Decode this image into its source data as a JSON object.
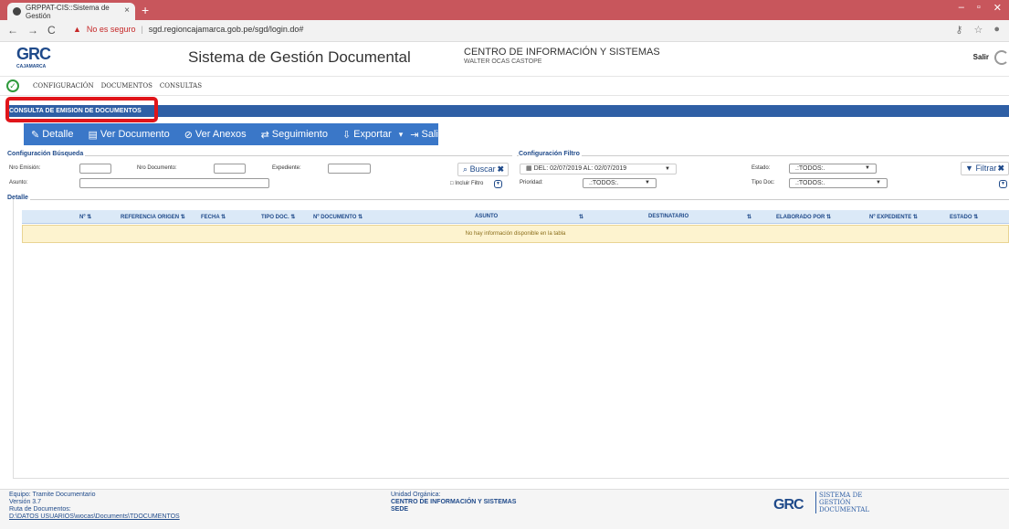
{
  "browser": {
    "tab_title": "GRPPAT-CIS::Sistema de Gestión",
    "tab_close": "×",
    "new_tab": "+",
    "not_secure": "No es seguro",
    "url": "sgd.regioncajamarca.gob.pe/sgd/login.do#"
  },
  "header": {
    "logo": "GRC",
    "logo_sub": "CAJAMARCA",
    "title": "Sistema de Gestión Documental",
    "unit": "CENTRO DE INFORMACIÓN Y SISTEMAS",
    "user": "WALTER OCAS CASTOPE",
    "exit": "Salir"
  },
  "menu": [
    "CONFIGURACIÓN",
    "DOCUMENTOS",
    "CONSULTAS"
  ],
  "panel_title": "CONSULTA DE EMISION DE DOCUMENTOS",
  "toolbar": {
    "detalle": "Detalle",
    "ver_documento": "Ver Documento",
    "ver_anexos": "Ver Anexos",
    "seguimiento": "Seguimiento",
    "exportar": "Exportar",
    "salir": "Salir"
  },
  "busqueda": {
    "legend": "Configuración Búsqueda",
    "nro_emision": "Nro Emisión:",
    "nro_documento": "Nro Documento:",
    "expediente": "Expediente:",
    "asunto": "Asunto:",
    "buscar": "Buscar",
    "incluir_filtro": "Incluir Filtro"
  },
  "filtro": {
    "legend": "Configuración Filtro",
    "fecha": "DEL: 02/07/2019 AL: 02/07/2019",
    "prioridad_label": "Prioridad:",
    "prioridad_value": ".:TODOS:.",
    "estado_label": "Estado:",
    "estado_value": ".:TODOS:.",
    "tipo_doc_label": "Tipo Doc:",
    "tipo_doc_value": ".:TODOS:.",
    "filtrar": "Filtrar"
  },
  "detalle": {
    "legend": "Detalle",
    "columns": [
      "Nº",
      "REFERENCIA ORIGEN",
      "FECHA",
      "TIPO DOC.",
      "Nº DOCUMENTO",
      "ASUNTO",
      "DESTINATARIO",
      "ELABORADO POR",
      "Nº EXPEDIENTE",
      "ESTADO"
    ],
    "empty": "No hay información disponible en la tabla"
  },
  "footer": {
    "equipo": "Equipo: Tramite Documentario",
    "version": "Versión 3.7",
    "ruta_label": "Ruta de Documentos:",
    "ruta": "D:\\DATOS USUARIOS\\wocas\\Documents\\TDOCUMENTOS",
    "unidad_label": "Unidad Orgánica:",
    "unidad": "CENTRO DE INFORMACIÓN Y SISTEMAS",
    "sede": "SEDE",
    "logo": "GRC",
    "logo_text_1": "SISTEMA DE",
    "logo_text_2": "GESTIÓN",
    "logo_text_3": "DOCUMENTAL"
  }
}
